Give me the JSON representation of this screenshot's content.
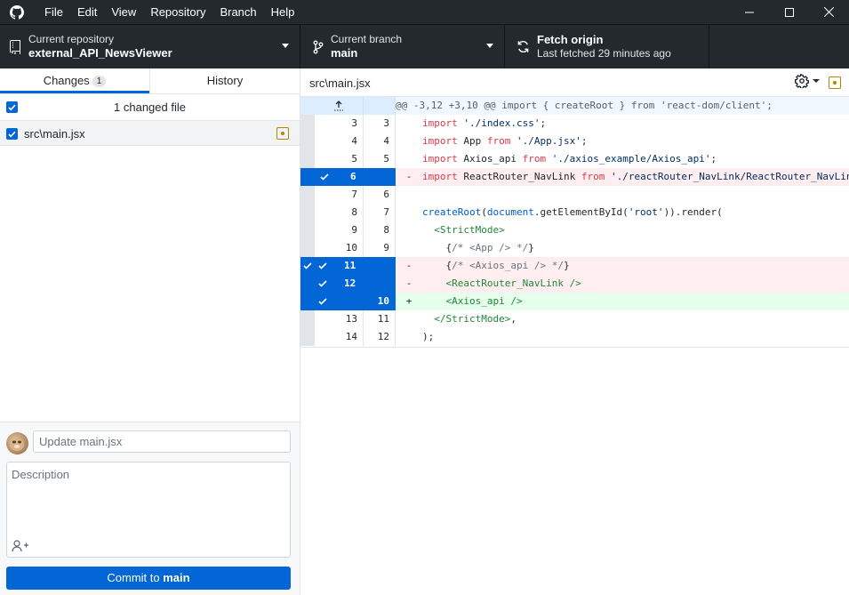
{
  "menu": {
    "items": [
      "File",
      "Edit",
      "View",
      "Repository",
      "Branch",
      "Help"
    ]
  },
  "toolbar": {
    "repo_label": "Current repository",
    "repo_name": "external_API_NewsViewer",
    "branch_label": "Current branch",
    "branch_name": "main",
    "fetch_label": "Fetch origin",
    "fetch_status": "Last fetched 29 minutes ago"
  },
  "sidebar": {
    "tab_changes": "Changes",
    "changes_count": "1",
    "tab_history": "History",
    "changed_files_label": "1 changed file",
    "file_path": "src\\main.jsx"
  },
  "commit": {
    "summary_placeholder": "Update main.jsx",
    "description_placeholder": "Description",
    "button_prefix": "Commit to",
    "button_branch": "main"
  },
  "diff": {
    "file_path": "src\\main.jsx",
    "hunk_header": "@@ -3,12 +3,10 @@ import { createRoot } from 'react-dom/client';",
    "lines": [
      {
        "old": "3",
        "new": "3",
        "marker": "",
        "type": "ctx",
        "code": "import './index.css';"
      },
      {
        "old": "4",
        "new": "4",
        "marker": "",
        "type": "ctx",
        "code": "import App from './App.jsx';"
      },
      {
        "old": "5",
        "new": "5",
        "marker": "",
        "type": "ctx",
        "code": "import Axios_api from './axios_example/Axios_api';"
      },
      {
        "old": "6",
        "new": "",
        "marker": "-",
        "type": "del",
        "code": "import ReactRouter_NavLink from './reactRouter_NavLink/ReactRouter_NavLink';"
      },
      {
        "old": "7",
        "new": "6",
        "marker": "",
        "type": "ctx",
        "code": ""
      },
      {
        "old": "8",
        "new": "7",
        "marker": "",
        "type": "ctx",
        "code": "createRoot(document.getElementById('root')).render("
      },
      {
        "old": "9",
        "new": "8",
        "marker": "",
        "type": "ctx",
        "code": "  <StrictMode>"
      },
      {
        "old": "10",
        "new": "9",
        "marker": "",
        "type": "ctx",
        "code": "    {/* <App /> */}"
      },
      {
        "old": "11",
        "new": "",
        "marker": "-",
        "type": "del",
        "code": "    {/* <Axios_api /> */}"
      },
      {
        "old": "12",
        "new": "",
        "marker": "-",
        "type": "del",
        "code": "    <ReactRouter_NavLink />"
      },
      {
        "old": "",
        "new": "10",
        "marker": "+",
        "type": "add",
        "code": "    <Axios_api />"
      },
      {
        "old": "13",
        "new": "11",
        "marker": "",
        "type": "ctx",
        "code": "  </StrictMode>,"
      },
      {
        "old": "14",
        "new": "12",
        "marker": "",
        "type": "ctx",
        "code": ");"
      }
    ]
  },
  "colors": {
    "accent": "#0366d6",
    "titlebar": "#24292e",
    "deleted_bg": "#ffeef0",
    "added_bg": "#e6ffed",
    "modified": "#b08800"
  },
  "icons": {
    "app_logo": "github-mark-icon",
    "repo": "repo-icon",
    "branch": "git-branch-icon",
    "fetch": "sync-icon",
    "settings": "gear-icon",
    "file_status": "file-modified-icon",
    "coauthor": "person-add-icon"
  }
}
